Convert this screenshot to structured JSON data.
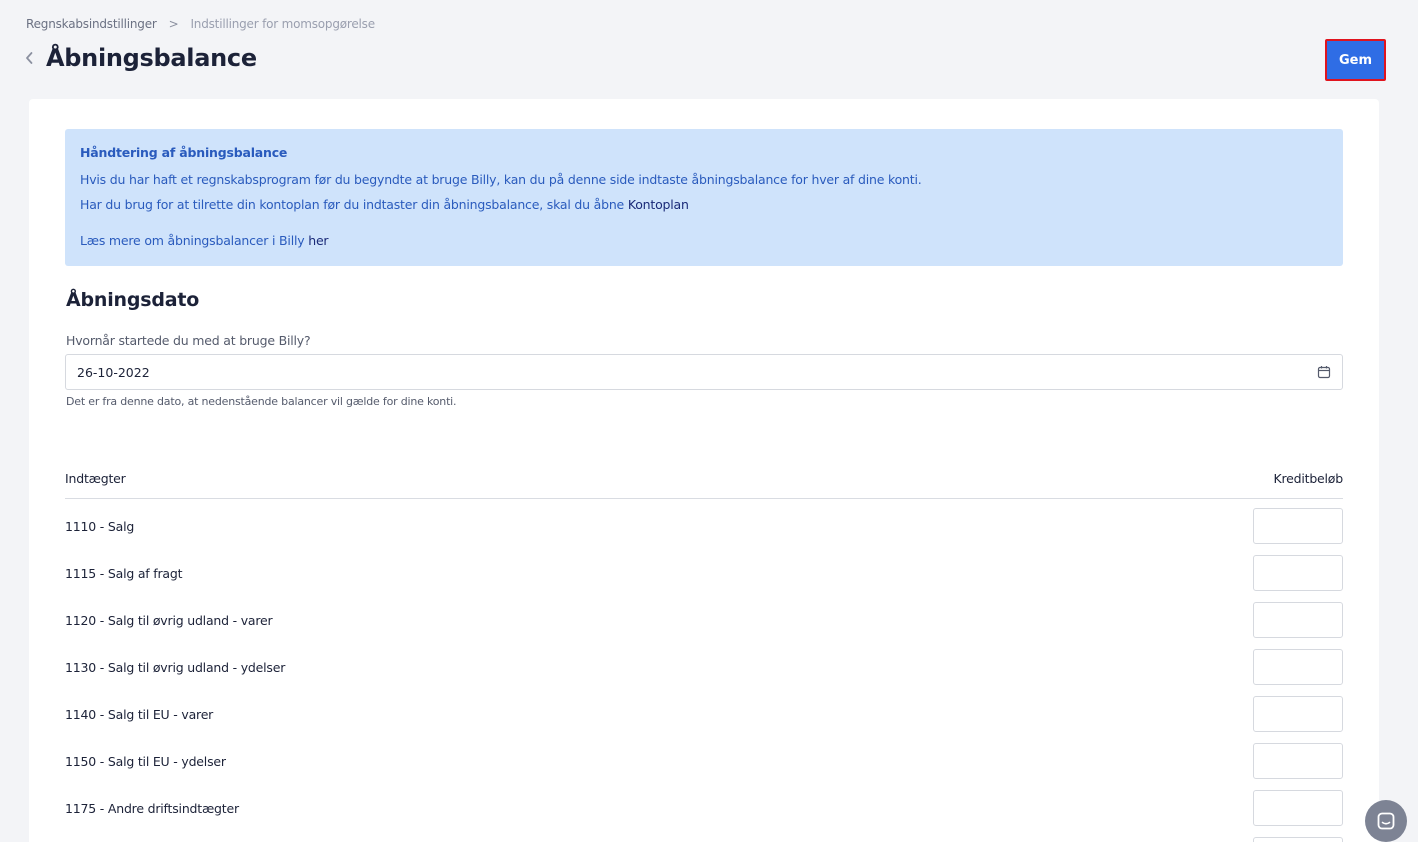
{
  "breadcrumb": {
    "parent": "Regnskabsindstillinger",
    "separator": ">",
    "current": "Indstillinger for momsopgørelse"
  },
  "header": {
    "title": "Åbningsbalance",
    "save_label": "Gem"
  },
  "info": {
    "heading": "Håndtering af åbningsbalance",
    "line1": "Hvis du har haft et regnskabsprogram før du begyndte at bruge Billy, kan du på denne side indtaste åbningsbalance for hver af dine konti.",
    "line2_prefix": "Har du brug for at tilrette din kontoplan før du indtaster din åbningsbalance, skal du åbne ",
    "line2_link": "Kontoplan",
    "line3_prefix": "Læs mere om åbningsbalancer i Billy ",
    "line3_link": "her"
  },
  "opening": {
    "section_title": "Åbningsdato",
    "label": "Hvornår startede du med at bruge Billy?",
    "date_value": "26-10-2022",
    "help": "Det er fra denne dato, at nedenstående balancer vil gælde for dine konti."
  },
  "table": {
    "col_account": "Indtægter",
    "col_amount": "Kreditbeløb",
    "rows": [
      "1110 - Salg",
      "1115 - Salg af fragt",
      "1120 - Salg til øvrig udland - varer",
      "1130 - Salg til øvrig udland - ydelser",
      "1140 - Salg til EU - varer",
      "1150 - Salg til EU - ydelser",
      "1175 - Andre driftsindtægter",
      ""
    ]
  },
  "colors": {
    "accent": "#2f6de5",
    "info_bg": "#cfe3fb",
    "info_text": "#2a5bbd"
  },
  "icons": {
    "back": "chevron-left-icon",
    "calendar": "calendar-icon",
    "chat": "chat-icon"
  }
}
